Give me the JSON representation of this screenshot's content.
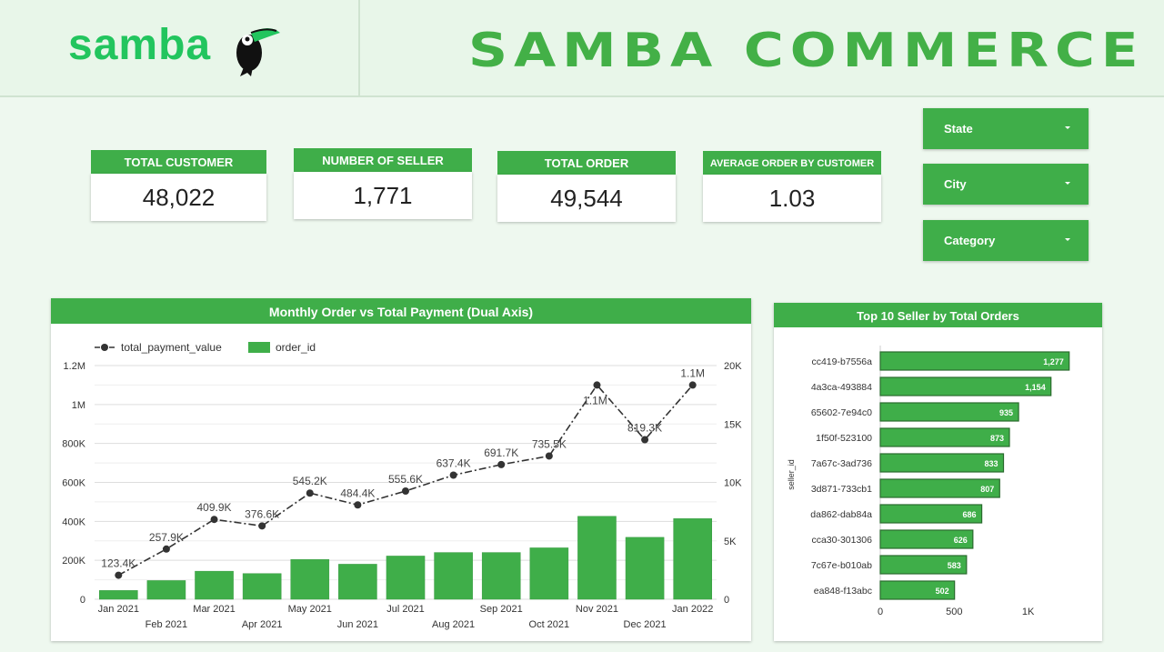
{
  "header": {
    "logo_text": "samba",
    "title": "SAMBA COMMERCE"
  },
  "kpis": [
    {
      "label": "TOTAL CUSTOMER",
      "value": "48,022"
    },
    {
      "label": "NUMBER OF SELLER",
      "value": "1,771"
    },
    {
      "label": "TOTAL ORDER",
      "value": "49,544"
    },
    {
      "label": "AVERAGE ORDER BY CUSTOMER",
      "value": "1.03"
    }
  ],
  "filters": [
    {
      "label": "State"
    },
    {
      "label": "City"
    },
    {
      "label": "Category"
    }
  ],
  "colors": {
    "accent": "#3fae49",
    "line": "#333333",
    "bar_border": "#2a6b2e"
  },
  "chart_data": [
    {
      "type": "bar+line",
      "title": "Monthly Order vs Total Payment (Dual Axis)",
      "categories": [
        "Jan 2021",
        "Feb 2021",
        "Mar 2021",
        "Apr 2021",
        "May 2021",
        "Jun 2021",
        "Jul 2021",
        "Aug 2021",
        "Sep 2021",
        "Oct 2021",
        "Nov 2021",
        "Dec 2021",
        "Jan 2022"
      ],
      "legend": [
        "total_payment_value",
        "order_id"
      ],
      "legend_position": "top-left",
      "series": [
        {
          "name": "total_payment_value",
          "axis": "left",
          "type": "line",
          "values": [
            123400,
            257900,
            409900,
            376600,
            545200,
            484400,
            555600,
            637400,
            691700,
            735500,
            1100000,
            819300,
            1100000
          ],
          "labels": [
            "123.4K",
            "257.9K",
            "409.9K",
            "376.6K",
            "545.2K",
            "484.4K",
            "555.6K",
            "637.4K",
            "691.7K",
            "735.5K",
            "1.1M",
            "819.3K",
            "1.1M"
          ]
        },
        {
          "name": "order_id",
          "axis": "right",
          "type": "bar",
          "values": [
            750,
            1600,
            2400,
            2200,
            3400,
            3000,
            3700,
            4000,
            4000,
            4400,
            7100,
            5300,
            6900
          ]
        }
      ],
      "y_left": {
        "min": 0,
        "max": 1200000,
        "ticks": [
          "0",
          "200K",
          "400K",
          "600K",
          "800K",
          "1M",
          "1.2M"
        ]
      },
      "y_right": {
        "min": 0,
        "max": 20000,
        "ticks": [
          "0",
          "5K",
          "10K",
          "15K",
          "20K"
        ]
      },
      "grid": true
    },
    {
      "type": "bar",
      "orientation": "horizontal",
      "title": "Top 10 Seller by Total Orders",
      "ylabel": "seller_id",
      "categories": [
        "cc419-b7556a",
        "4a3ca-493884",
        "65602-7e94c0",
        "1f50f-523100",
        "7a67c-3ad736",
        "3d871-733cb1",
        "da862-dab84a",
        "cca30-301306",
        "7c67e-b010ab",
        "ea848-f13abc"
      ],
      "values": [
        1277,
        1154,
        935,
        873,
        833,
        807,
        686,
        626,
        583,
        502
      ],
      "value_labels": [
        "1,277",
        "1,154",
        "935",
        "873",
        "833",
        "807",
        "686",
        "626",
        "583",
        "502"
      ],
      "xlim": [
        0,
        1500
      ],
      "x_ticks": [
        "0",
        "500",
        "1K"
      ]
    }
  ]
}
